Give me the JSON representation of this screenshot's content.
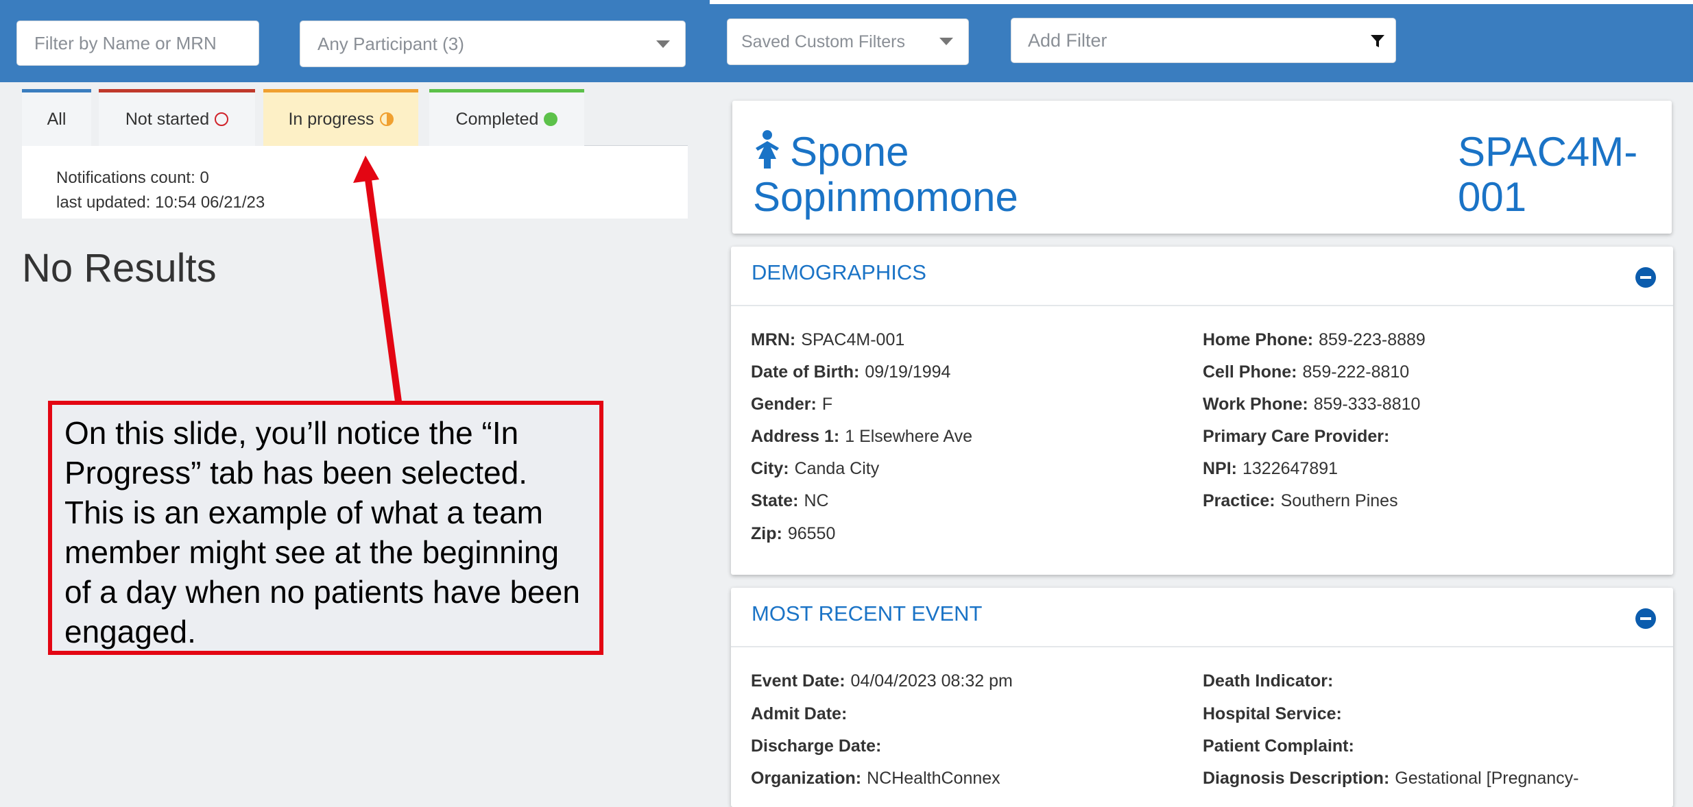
{
  "filters": {
    "name_placeholder": "Filter by Name or MRN",
    "participant_value": "Any Participant (3)",
    "saved_filters_value": "Saved Custom Filters",
    "add_filter_placeholder": "Add Filter"
  },
  "tabs": [
    {
      "label": "All",
      "color": "#3a7dbf"
    },
    {
      "label": "Not started",
      "color": "#c0392b"
    },
    {
      "label": "In progress",
      "color": "#f0a030"
    },
    {
      "label": "Completed",
      "color": "#5cc14a"
    }
  ],
  "notifications": {
    "count_text": "Notifications count: 0",
    "updated_text": "last updated: 10:54 06/21/23"
  },
  "no_results": "No Results",
  "callout": {
    "text": "On this slide, you’ll notice the “In Progress” tab has been selected. This is an example of what a team member might see at the beginning of a day when no patients have been engaged."
  },
  "patient": {
    "first_name": "Spone",
    "last_name": "Sopinmomone",
    "id_line1": "SPAC4M-",
    "id_line2": "001"
  },
  "demographics": {
    "title": "DEMOGRAPHICS",
    "left": [
      {
        "label": "MRN:",
        "value": "SPAC4M-001"
      },
      {
        "label": "Date of Birth:",
        "value": "09/19/1994"
      },
      {
        "label": "Gender:",
        "value": "F"
      },
      {
        "label": "Address 1:",
        "value": "1 Elsewhere Ave"
      },
      {
        "label": "City:",
        "value": "Canda City"
      },
      {
        "label": "State:",
        "value": "NC"
      },
      {
        "label": "Zip:",
        "value": "96550"
      }
    ],
    "right": [
      {
        "label": "Home Phone:",
        "value": "859-223-8889"
      },
      {
        "label": "Cell Phone:",
        "value": "859-222-8810"
      },
      {
        "label": "Work Phone:",
        "value": "859-333-8810"
      },
      {
        "label": "Primary Care Provider:",
        "value": ""
      },
      {
        "label": "NPI:",
        "value": "1322647891"
      },
      {
        "label": "Practice:",
        "value": "Southern Pines"
      }
    ]
  },
  "recent_event": {
    "title": "MOST RECENT EVENT",
    "left": [
      {
        "label": "Event Date:",
        "value": "04/04/2023 08:32 pm"
      },
      {
        "label": "Admit Date:",
        "value": ""
      },
      {
        "label": "Discharge Date:",
        "value": ""
      },
      {
        "label": "Organization:",
        "value": "NCHealthConnex"
      }
    ],
    "right": [
      {
        "label": "Death Indicator:",
        "value": ""
      },
      {
        "label": "Hospital Service:",
        "value": ""
      },
      {
        "label": "Patient Complaint:",
        "value": ""
      },
      {
        "label": "Diagnosis Description:",
        "value": "Gestational [Pregnancy-"
      }
    ]
  }
}
